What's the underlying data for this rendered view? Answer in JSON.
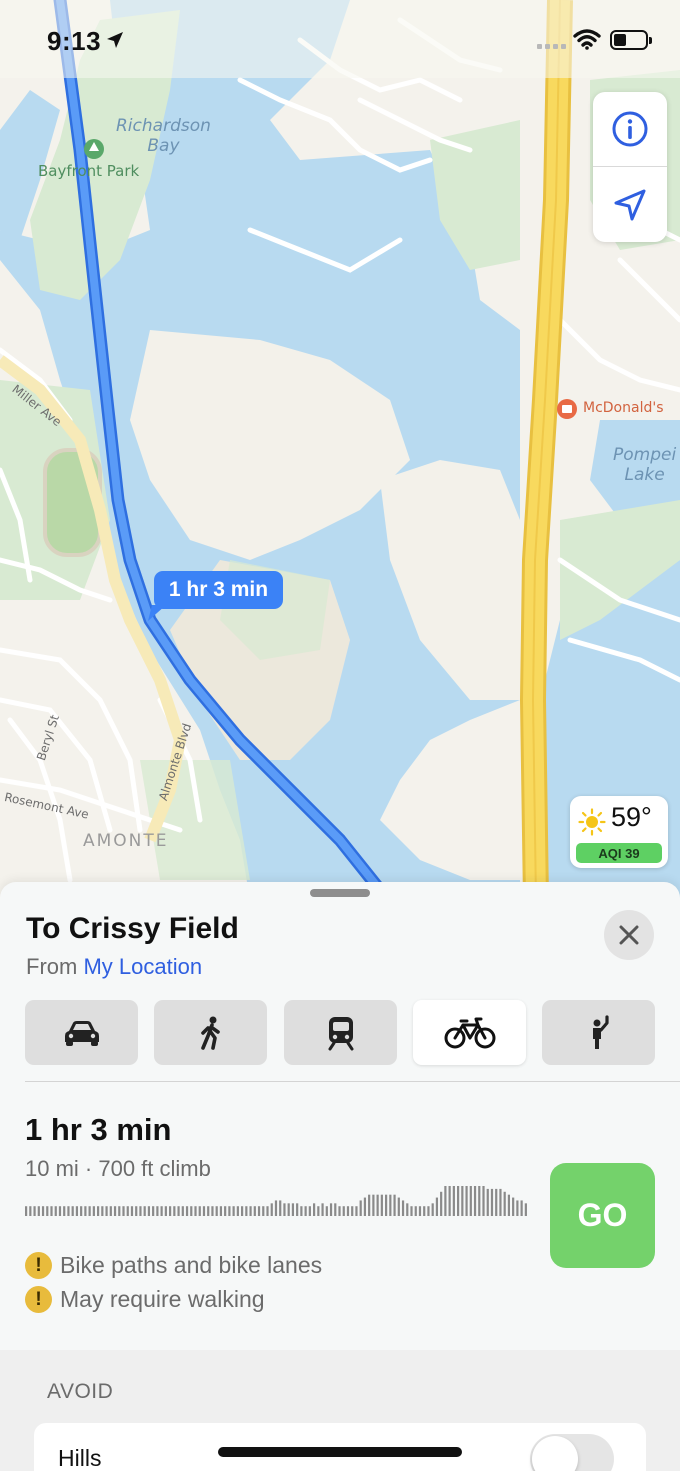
{
  "status": {
    "time": "9:13"
  },
  "map": {
    "labels": {
      "richardson_bay_1": "Richardson",
      "richardson_bay_2": "Bay",
      "bayfront_park": "Bayfront Park",
      "miller_ave": "Miller Ave",
      "mcdonalds": "McDonald's",
      "pompei_lake_1": "Pompei",
      "pompei_lake_2": "Lake",
      "beryl_st": "Beryl St",
      "rosemont_ave": "Rosemont Ave",
      "almonte_blvd": "Almonte Blvd",
      "amonte": "AMONTE"
    },
    "route_bubble": "1 hr 3 min",
    "weather": {
      "temp": "59°",
      "aqi": "AQI 39"
    },
    "colors": {
      "route": "#3b82f6",
      "water": "#b8daf0",
      "park": "#d8ead2",
      "highway": "#f5d45a"
    }
  },
  "sheet": {
    "destination": "To Crissy Field",
    "from_prefix": "From",
    "from_location": "My Location",
    "modes": [
      {
        "name": "drive",
        "icon": "car-icon",
        "active": false
      },
      {
        "name": "walk",
        "icon": "walking-icon",
        "active": false
      },
      {
        "name": "transit",
        "icon": "train-icon",
        "active": false
      },
      {
        "name": "cycle",
        "icon": "bicycle-icon",
        "active": true
      },
      {
        "name": "rideshare",
        "icon": "hailing-person-icon",
        "active": false
      }
    ],
    "duration": "1 hr 3 min",
    "distance": "10 mi · 700 ft climb",
    "go_label": "GO",
    "warnings": [
      "Bike paths and bike lanes",
      "May require walking"
    ],
    "elevation_profile": [
      2,
      2,
      2,
      2,
      2,
      2,
      2,
      2,
      2,
      2,
      2,
      2,
      2,
      2,
      2,
      2,
      2,
      2,
      2,
      2,
      2,
      2,
      2,
      2,
      2,
      2,
      2,
      2,
      2,
      2,
      2,
      2,
      2,
      2,
      2,
      2,
      2,
      2,
      2,
      2,
      2,
      2,
      2,
      2,
      2,
      2,
      2,
      2,
      2,
      2,
      2,
      2,
      2,
      2,
      2,
      2,
      2,
      2,
      3,
      4,
      4,
      3,
      3,
      3,
      3,
      2,
      2,
      2,
      3,
      2,
      3,
      2,
      3,
      3,
      2,
      2,
      2,
      2,
      2,
      4,
      5,
      6,
      6,
      6,
      6,
      6,
      6,
      6,
      5,
      4,
      3,
      2,
      2,
      2,
      2,
      2,
      3,
      5,
      7,
      9,
      9,
      9,
      9,
      9,
      9,
      9,
      9,
      9,
      9,
      8,
      8,
      8,
      8,
      7,
      6,
      5,
      4,
      4,
      3
    ]
  },
  "avoid": {
    "heading": "AVOID",
    "hills_label": "Hills",
    "hills_on": false
  }
}
